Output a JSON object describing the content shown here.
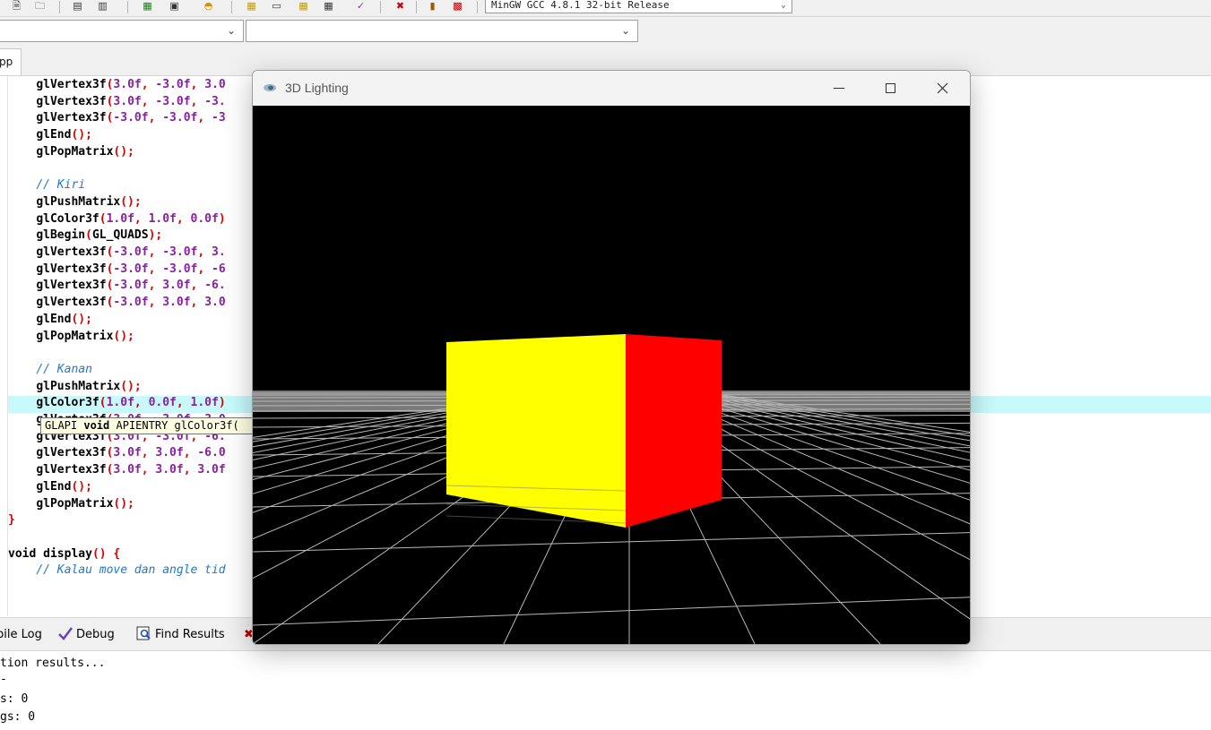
{
  "toolbar": {
    "compiler": "MinGW GCC 4.8.1 32-bit Release",
    "icons": [
      "new-project-icon",
      "open-project-icon",
      "save-icon",
      "save-all-icon",
      "compile-icon",
      "run-icon",
      "debug-smile-icon",
      "layout-icons",
      "check-icon",
      "stop-icon",
      "profile-icon",
      "delete-profile-icon"
    ]
  },
  "file_tab": {
    "label": "pp"
  },
  "editor": {
    "lines": [
      {
        "indent": "    ",
        "segs": [
          [
            "fn",
            "glVertex3f"
          ],
          [
            "p",
            "("
          ],
          [
            "num",
            "3.0f"
          ],
          [
            "p",
            ", "
          ],
          [
            "num",
            "-3.0f"
          ],
          [
            "p",
            ", "
          ],
          [
            "num",
            "3.0"
          ]
        ]
      },
      {
        "indent": "    ",
        "segs": [
          [
            "fn",
            "glVertex3f"
          ],
          [
            "p",
            "("
          ],
          [
            "num",
            "3.0f"
          ],
          [
            "p",
            ", "
          ],
          [
            "num",
            "-3.0f"
          ],
          [
            "p",
            ", "
          ],
          [
            "num",
            "-3."
          ]
        ]
      },
      {
        "indent": "    ",
        "segs": [
          [
            "fn",
            "glVertex3f"
          ],
          [
            "p",
            "("
          ],
          [
            "num",
            "-3.0f"
          ],
          [
            "p",
            ", "
          ],
          [
            "num",
            "-3.0f"
          ],
          [
            "p",
            ", "
          ],
          [
            "num",
            "-3"
          ]
        ]
      },
      {
        "indent": "    ",
        "segs": [
          [
            "fn",
            "glEnd"
          ],
          [
            "p",
            "();"
          ]
        ]
      },
      {
        "indent": "    ",
        "segs": [
          [
            "fn",
            "glPopMatrix"
          ],
          [
            "p",
            "();"
          ]
        ]
      },
      {
        "indent": "",
        "segs": []
      },
      {
        "indent": "    ",
        "segs": [
          [
            "com",
            "// Kiri"
          ]
        ]
      },
      {
        "indent": "    ",
        "segs": [
          [
            "fn",
            "glPushMatrix"
          ],
          [
            "p",
            "();"
          ]
        ]
      },
      {
        "indent": "    ",
        "segs": [
          [
            "fn",
            "glColor3f"
          ],
          [
            "p",
            "("
          ],
          [
            "num",
            "1.0f"
          ],
          [
            "p",
            ", "
          ],
          [
            "num",
            "1.0f"
          ],
          [
            "p",
            ", "
          ],
          [
            "num",
            "0.0f"
          ],
          [
            "p",
            ")"
          ]
        ]
      },
      {
        "indent": "    ",
        "segs": [
          [
            "fn",
            "glBegin"
          ],
          [
            "p",
            "("
          ],
          [
            "fn",
            "GL_QUADS"
          ],
          [
            "p",
            ");"
          ]
        ]
      },
      {
        "indent": "    ",
        "segs": [
          [
            "fn",
            "glVertex3f"
          ],
          [
            "p",
            "("
          ],
          [
            "num",
            "-3.0f"
          ],
          [
            "p",
            ", "
          ],
          [
            "num",
            "-3.0f"
          ],
          [
            "p",
            ", "
          ],
          [
            "num",
            "3."
          ]
        ]
      },
      {
        "indent": "    ",
        "segs": [
          [
            "fn",
            "glVertex3f"
          ],
          [
            "p",
            "("
          ],
          [
            "num",
            "-3.0f"
          ],
          [
            "p",
            ", "
          ],
          [
            "num",
            "-3.0f"
          ],
          [
            "p",
            ", "
          ],
          [
            "num",
            "-6"
          ]
        ]
      },
      {
        "indent": "    ",
        "segs": [
          [
            "fn",
            "glVertex3f"
          ],
          [
            "p",
            "("
          ],
          [
            "num",
            "-3.0f"
          ],
          [
            "p",
            ", "
          ],
          [
            "num",
            "3.0f"
          ],
          [
            "p",
            ", "
          ],
          [
            "num",
            "-6."
          ]
        ]
      },
      {
        "indent": "    ",
        "segs": [
          [
            "fn",
            "glVertex3f"
          ],
          [
            "p",
            "("
          ],
          [
            "num",
            "-3.0f"
          ],
          [
            "p",
            ", "
          ],
          [
            "num",
            "3.0f"
          ],
          [
            "p",
            ", "
          ],
          [
            "num",
            "3.0"
          ]
        ]
      },
      {
        "indent": "    ",
        "segs": [
          [
            "fn",
            "glEnd"
          ],
          [
            "p",
            "();"
          ]
        ]
      },
      {
        "indent": "    ",
        "segs": [
          [
            "fn",
            "glPopMatrix"
          ],
          [
            "p",
            "();"
          ]
        ]
      },
      {
        "indent": "",
        "segs": []
      },
      {
        "indent": "    ",
        "segs": [
          [
            "com",
            "// Kanan"
          ]
        ]
      },
      {
        "indent": "    ",
        "segs": [
          [
            "fn",
            "glPushMatrix"
          ],
          [
            "p",
            "();"
          ]
        ]
      },
      {
        "indent": "    ",
        "segs": [
          [
            "fn",
            "glColor3f"
          ],
          [
            "p",
            "("
          ],
          [
            "num",
            "1.0f"
          ],
          [
            "p",
            ", "
          ],
          [
            "num",
            "0.0f"
          ],
          [
            "p",
            ", "
          ],
          [
            "num",
            "1.0f"
          ],
          [
            "p",
            ")"
          ]
        ]
      },
      {
        "indent": "    ",
        "segs": [
          [
            "fn",
            "glVertex3f"
          ],
          [
            "p",
            "("
          ],
          [
            "num",
            "3.0f"
          ],
          [
            "p",
            ", "
          ],
          [
            "num",
            "-3.0f"
          ],
          [
            "p",
            ", "
          ],
          [
            "num",
            "3.0"
          ]
        ]
      },
      {
        "indent": "    ",
        "segs": [
          [
            "fn",
            "glVertex3f"
          ],
          [
            "p",
            "("
          ],
          [
            "num",
            "3.0f"
          ],
          [
            "p",
            ", "
          ],
          [
            "num",
            "-3.0f"
          ],
          [
            "p",
            ", "
          ],
          [
            "num",
            "-6."
          ]
        ]
      },
      {
        "indent": "    ",
        "segs": [
          [
            "fn",
            "glVertex3f"
          ],
          [
            "p",
            "("
          ],
          [
            "num",
            "3.0f"
          ],
          [
            "p",
            ", "
          ],
          [
            "num",
            "3.0f"
          ],
          [
            "p",
            ", "
          ],
          [
            "num",
            "-6.0"
          ]
        ]
      },
      {
        "indent": "    ",
        "segs": [
          [
            "fn",
            "glVertex3f"
          ],
          [
            "p",
            "("
          ],
          [
            "num",
            "3.0f"
          ],
          [
            "p",
            ", "
          ],
          [
            "num",
            "3.0f"
          ],
          [
            "p",
            ", "
          ],
          [
            "num",
            "3.0f"
          ]
        ]
      },
      {
        "indent": "    ",
        "segs": [
          [
            "fn",
            "glEnd"
          ],
          [
            "p",
            "();"
          ]
        ]
      },
      {
        "indent": "    ",
        "segs": [
          [
            "fn",
            "glPopMatrix"
          ],
          [
            "p",
            "();"
          ]
        ]
      },
      {
        "indent": "",
        "segs": [
          [
            "p",
            "}"
          ]
        ]
      },
      {
        "indent": "",
        "segs": []
      },
      {
        "indent": "",
        "segs": [
          [
            "kw",
            "void "
          ],
          [
            "fn",
            "display"
          ],
          [
            "p",
            "() {"
          ]
        ]
      },
      {
        "indent": "    ",
        "segs": [
          [
            "com",
            "// Kalau move dan angle tid"
          ]
        ]
      }
    ],
    "tooltip": {
      "prefix": "GLAPI ",
      "bold": "void",
      "rest": " APIENTRY glColor3f("
    }
  },
  "bottom_panel": {
    "tabs": [
      {
        "label": "pile Log",
        "icon": "compile-log-icon"
      },
      {
        "label": "Debug",
        "icon": "debug-check-icon"
      },
      {
        "label": "Find Results",
        "icon": "find-results-icon"
      }
    ],
    "log_lines": [
      "tion results...",
      "-",
      "s: 0",
      "gs: 0"
    ]
  },
  "gl_window": {
    "title": "3D Lighting",
    "icon": "opengl-eye-icon",
    "controls": [
      "minimize-icon",
      "maximize-icon",
      "close-icon"
    ]
  },
  "scene": {
    "background": "#000000",
    "floor_color": "#8f8f8f",
    "grid_color": "#b8b8b8",
    "cube_left_face": "#ffff00",
    "cube_right_face": "#ff0000"
  }
}
